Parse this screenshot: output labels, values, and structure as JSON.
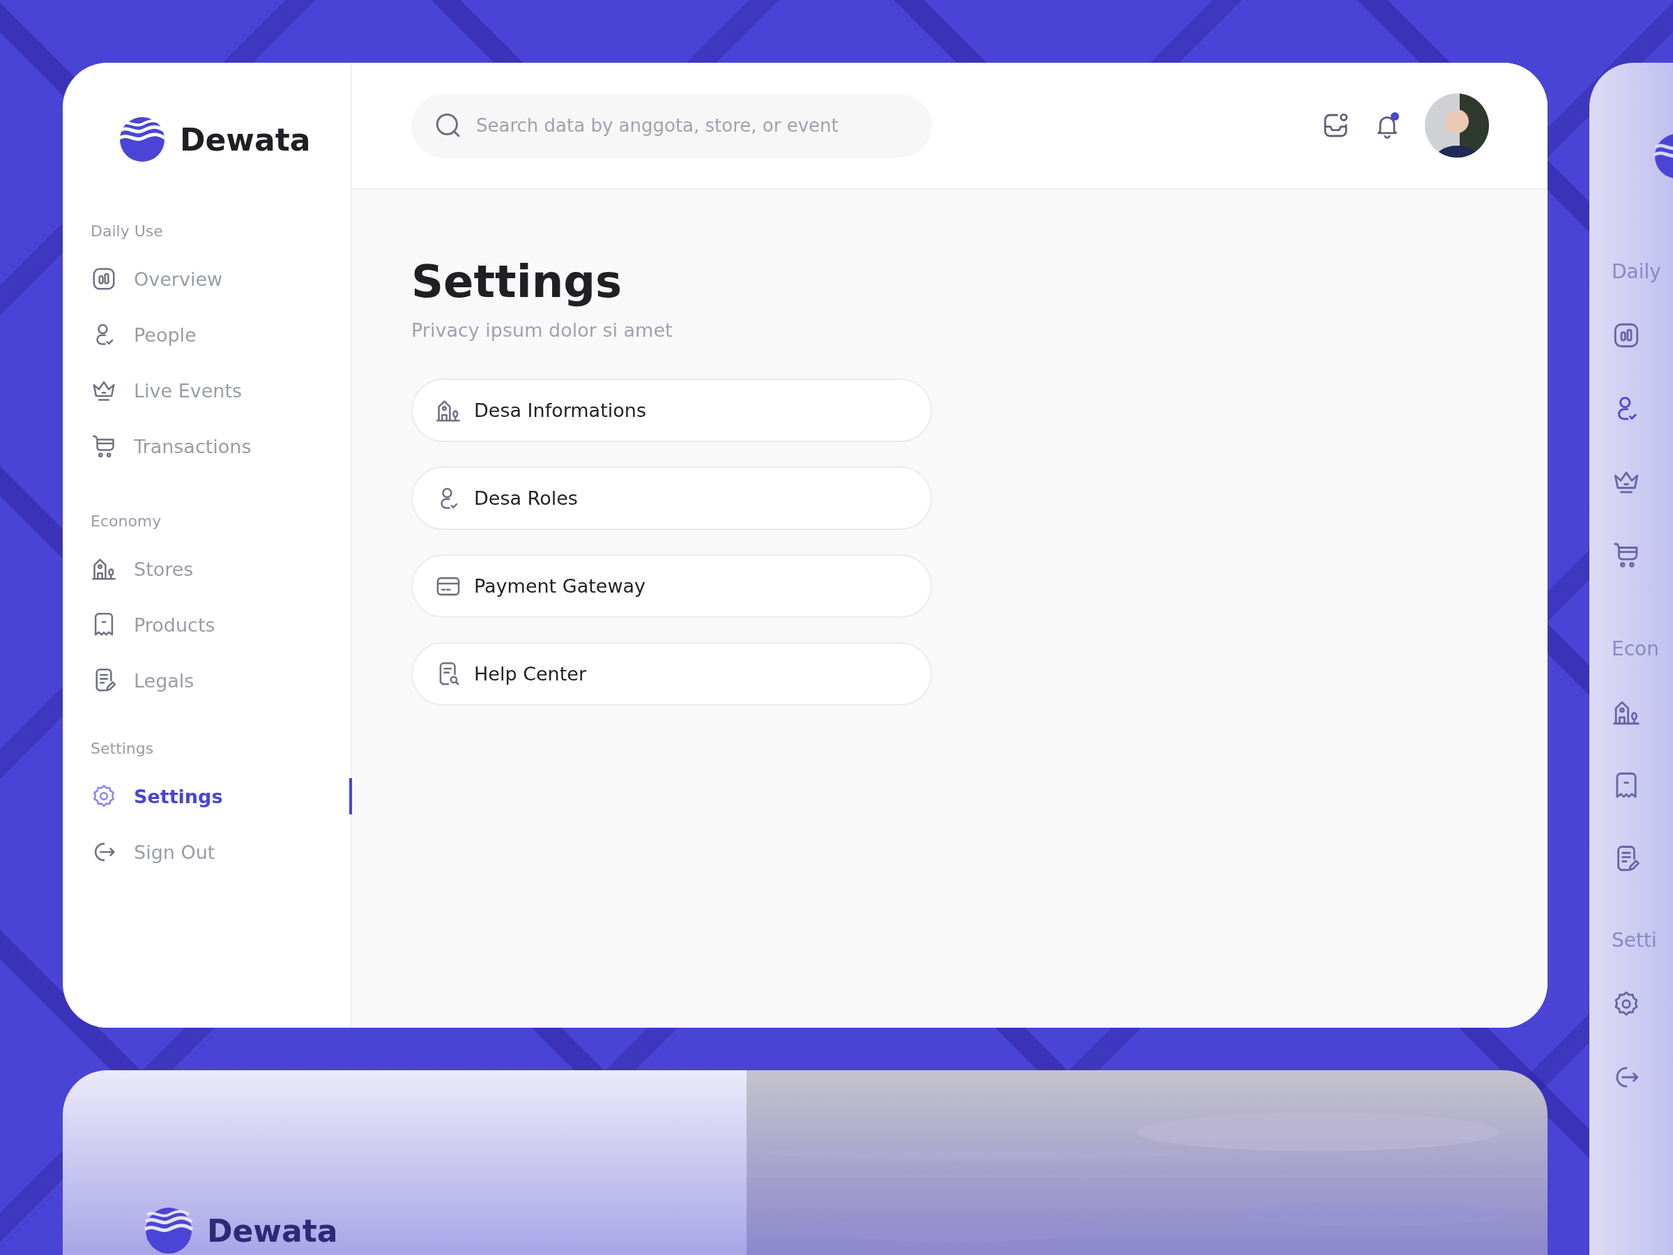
{
  "brand": {
    "name": "Dewata"
  },
  "sidebar": {
    "sections": [
      {
        "title": "Daily Use",
        "items": [
          {
            "label": "Overview",
            "selected": false
          },
          {
            "label": "People",
            "selected": false
          },
          {
            "label": "Live Events",
            "selected": false
          },
          {
            "label": "Transactions",
            "selected": false
          }
        ]
      },
      {
        "title": "Economy",
        "items": [
          {
            "label": "Stores",
            "selected": false
          },
          {
            "label": "Products",
            "selected": false
          },
          {
            "label": "Legals",
            "selected": false
          }
        ]
      },
      {
        "title": "Settings",
        "items": [
          {
            "label": "Settings",
            "selected": true
          },
          {
            "label": "Sign Out",
            "selected": false
          }
        ]
      }
    ]
  },
  "header": {
    "search": {
      "placeholder": "Search data by anggota, store, or event"
    },
    "notifications": {
      "unread": true
    }
  },
  "page": {
    "title": "Settings",
    "subtitle": "Privacy ipsum dolor si amet"
  },
  "settings_items": [
    {
      "label": "Desa Informations"
    },
    {
      "label": "Desa Roles"
    },
    {
      "label": "Payment Gateway"
    },
    {
      "label": "Help Center"
    }
  ],
  "right_preview": {
    "sections": [
      {
        "title": "Daily",
        "items": [
          {
            "selected": false
          },
          {
            "selected": true
          },
          {
            "selected": false
          },
          {
            "selected": false
          }
        ]
      },
      {
        "title": "Econ",
        "items": [
          {
            "selected": false
          },
          {
            "selected": false
          },
          {
            "selected": false
          }
        ]
      },
      {
        "title": "Setti",
        "items": [
          {
            "selected": false
          },
          {
            "selected": false
          }
        ]
      }
    ]
  },
  "bottom_preview": {
    "brand": "Dewata"
  }
}
